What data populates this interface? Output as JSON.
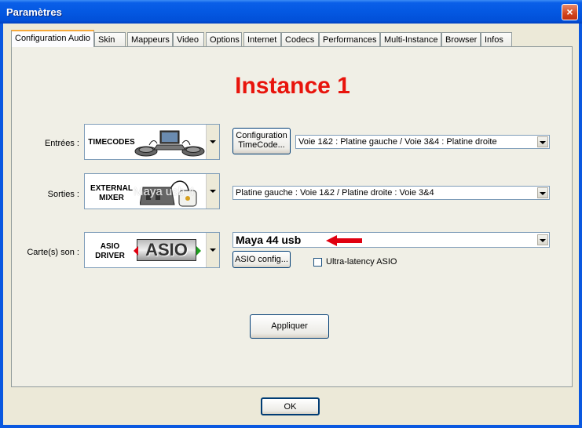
{
  "window": {
    "title": "Paramètres",
    "close_glyph": "×"
  },
  "tabs": [
    {
      "label": "Configuration Audio",
      "active": true
    },
    {
      "label": "Skin"
    },
    {
      "label": "Mappeurs"
    },
    {
      "label": "Video"
    },
    {
      "label": "Options"
    },
    {
      "label": "Internet"
    },
    {
      "label": "Codecs"
    },
    {
      "label": "Performances"
    },
    {
      "label": "Multi-Instance"
    },
    {
      "label": "Browser"
    },
    {
      "label": "Infos"
    }
  ],
  "heading": "Instance 1",
  "colors": {
    "heading": "#e8140c",
    "arrow": "#e00010",
    "title_bar": "#0458e2"
  },
  "inputs": {
    "label": "Entrées :",
    "image_text": "TIMECODES",
    "config_button": "Configuration TimeCode...",
    "routing_value": "Voie 1&2 : Platine gauche / Voie 3&4 : Platine droite"
  },
  "outputs": {
    "label": "Sorties :",
    "image_text": "EXTERNAL MIXER",
    "image_overlay": "Maya usb 4",
    "routing_value": "Platine gauche : Voie 1&2 / Platine droite : Voie 3&4"
  },
  "soundcard": {
    "label": "Carte(s) son :",
    "image_text": "ASIO DRIVER",
    "logo_text": "ASIO",
    "device_value": "Maya 44 usb",
    "asio_config_button": "ASIO config...",
    "ultra_latency_label": "Ultra-latency ASIO",
    "ultra_latency_checked": false
  },
  "apply_button": "Appliquer",
  "ok_button": "OK"
}
